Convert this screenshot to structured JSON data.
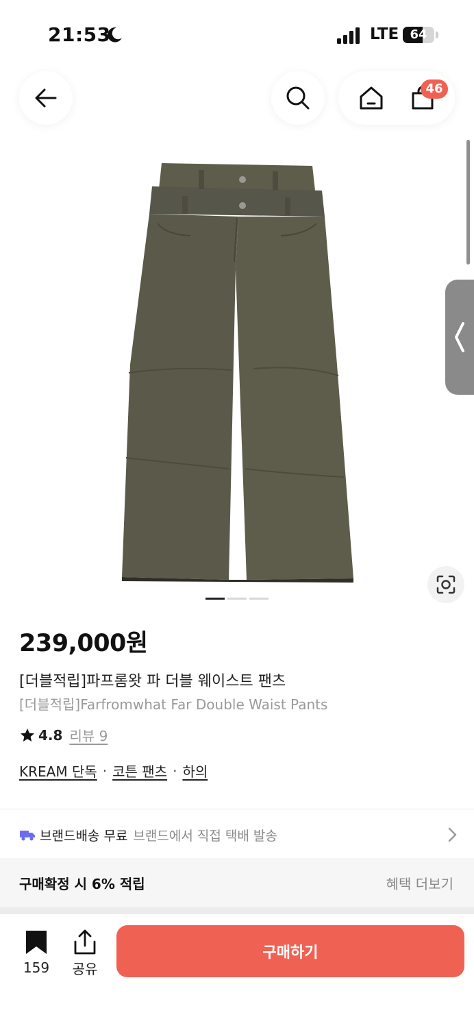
{
  "status_bar": {
    "time": "21:53",
    "network": "LTE",
    "battery": "64",
    "battery_level": 0.64
  },
  "header": {
    "cart_badge": "46",
    "icons": [
      "back-arrow-icon",
      "search-icon",
      "home-icon",
      "cart-icon"
    ]
  },
  "gallery": {
    "page_count": 3,
    "active_index": 0
  },
  "product": {
    "price": "239,000원",
    "name_ko": "[더블적립]파프롬왓 파 더블 웨이스트 팬츠",
    "name_en": "[더블적립]Farfromwhat Far Double Waist Pants",
    "rating": "4.8",
    "review": "리뷰 9",
    "tags": [
      "KREAM 단독",
      "코튼 팬츠",
      "하의"
    ],
    "tag_separator": "·"
  },
  "shipping": {
    "title": "브랜드배송 무료",
    "description": "브랜드에서 직접 택배 발송"
  },
  "benefit": {
    "title": "구매확정 시 6% 적립",
    "link": "혜택 더보기"
  },
  "bottom_bar": {
    "bookmark_count": "159",
    "share_label": "공유",
    "buy_label": "구매하기"
  },
  "colors": {
    "accent": "#ef6253",
    "pants": "#5e5d4c",
    "truck": "#6b6cf0"
  }
}
